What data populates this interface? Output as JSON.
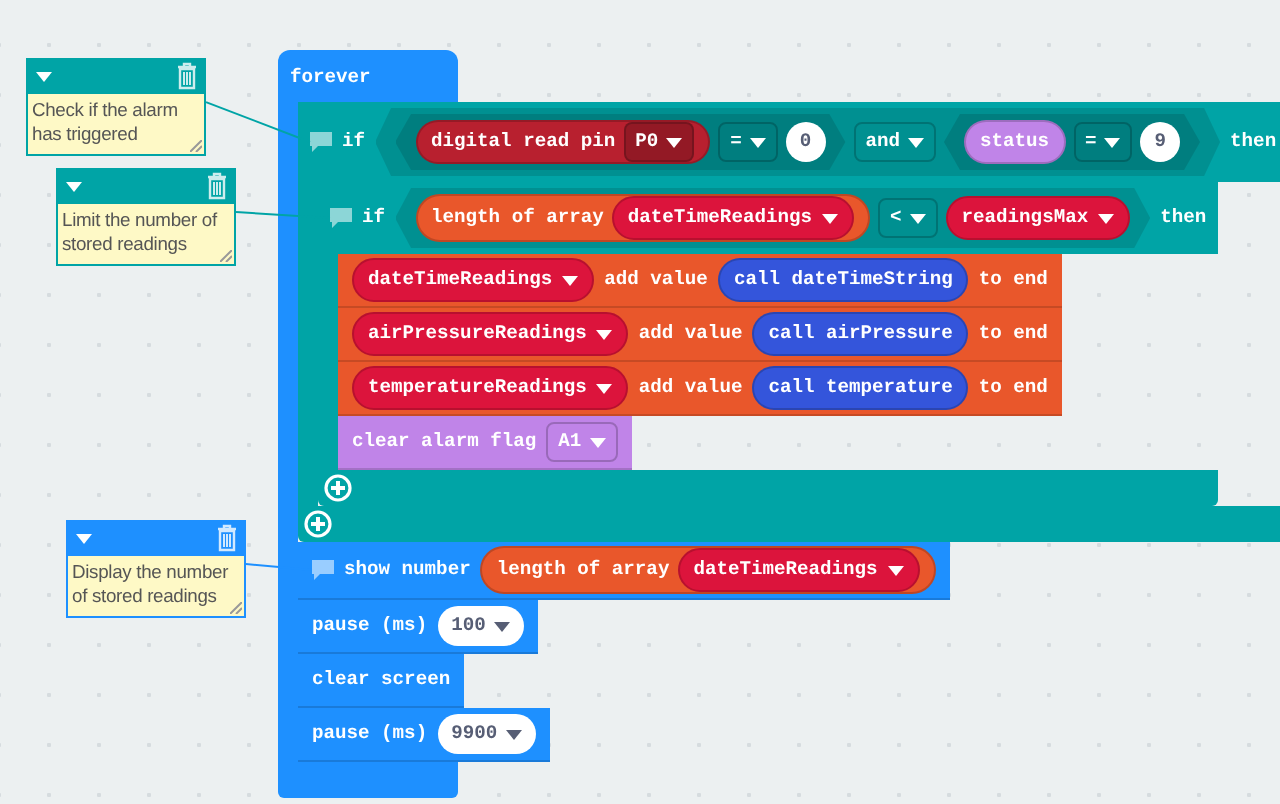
{
  "program": {
    "kind": "event",
    "color": "#1e90ff",
    "parts": [
      {
        "kind": "label",
        "text": "forever"
      }
    ],
    "children": [
      {
        "kind": "if",
        "color": "#00a4a6",
        "comment": "Check if the alarm has triggered",
        "parts": [
          {
            "kind": "label",
            "text": "if"
          },
          {
            "kind": "boolean",
            "parts": [
              {
                "kind": "boolean",
                "parts": [
                  {
                    "kind": "reporter",
                    "color": "#b8202f",
                    "parts": [
                      {
                        "kind": "label",
                        "text": "digital read pin"
                      },
                      {
                        "kind": "dropdown",
                        "text": "P0"
                      }
                    ]
                  },
                  {
                    "kind": "dropdown",
                    "text": "="
                  },
                  {
                    "kind": "number",
                    "text": "0"
                  }
                ]
              },
              {
                "kind": "dropdown",
                "text": "and"
              },
              {
                "kind": "boolean",
                "parts": [
                  {
                    "kind": "reporter",
                    "color": "#c084e8",
                    "parts": [
                      {
                        "kind": "label",
                        "text": "status"
                      }
                    ]
                  },
                  {
                    "kind": "dropdown",
                    "text": "="
                  },
                  {
                    "kind": "number",
                    "text": "9"
                  }
                ]
              }
            ]
          },
          {
            "kind": "label",
            "text": "then"
          }
        ],
        "children": [
          {
            "kind": "if",
            "color": "#00a4a6",
            "comment": "Limit the number of stored readings",
            "parts": [
              {
                "kind": "label",
                "text": "if"
              },
              {
                "kind": "boolean",
                "parts": [
                  {
                    "kind": "reporter",
                    "color": "#e9572b",
                    "parts": [
                      {
                        "kind": "label",
                        "text": "length of array"
                      },
                      {
                        "kind": "variable",
                        "text": "dateTimeReadings"
                      }
                    ]
                  },
                  {
                    "kind": "dropdown",
                    "text": "<"
                  },
                  {
                    "kind": "variable",
                    "text": "readingsMax"
                  }
                ]
              },
              {
                "kind": "label",
                "text": "then"
              }
            ],
            "children": [
              {
                "kind": "statement",
                "color": "#e9572b",
                "parts": [
                  {
                    "kind": "variable",
                    "text": "dateTimeReadings"
                  },
                  {
                    "kind": "label",
                    "text": "add value"
                  },
                  {
                    "kind": "reporter",
                    "color": "#3455db",
                    "parts": [
                      {
                        "kind": "label",
                        "text": "call dateTimeString"
                      }
                    ]
                  },
                  {
                    "kind": "label",
                    "text": "to end"
                  }
                ]
              },
              {
                "kind": "statement",
                "color": "#e9572b",
                "parts": [
                  {
                    "kind": "variable",
                    "text": "airPressureReadings"
                  },
                  {
                    "kind": "label",
                    "text": "add value"
                  },
                  {
                    "kind": "reporter",
                    "color": "#3455db",
                    "parts": [
                      {
                        "kind": "label",
                        "text": "call airPressure"
                      }
                    ]
                  },
                  {
                    "kind": "label",
                    "text": "to end"
                  }
                ]
              },
              {
                "kind": "statement",
                "color": "#e9572b",
                "parts": [
                  {
                    "kind": "variable",
                    "text": "temperatureReadings"
                  },
                  {
                    "kind": "label",
                    "text": "add value"
                  },
                  {
                    "kind": "reporter",
                    "color": "#3455db",
                    "parts": [
                      {
                        "kind": "label",
                        "text": "call temperature"
                      }
                    ]
                  },
                  {
                    "kind": "label",
                    "text": "to end"
                  }
                ]
              },
              {
                "kind": "statement",
                "color": "#c084e8",
                "parts": [
                  {
                    "kind": "label",
                    "text": "clear alarm flag"
                  },
                  {
                    "kind": "dropdown",
                    "text": "A1"
                  }
                ]
              }
            ]
          }
        ]
      },
      {
        "kind": "statement",
        "color": "#1e90ff",
        "comment": "Display the number of stored readings",
        "parts": [
          {
            "kind": "label",
            "text": "show number"
          },
          {
            "kind": "reporter",
            "color": "#e9572b",
            "parts": [
              {
                "kind": "label",
                "text": "length of array"
              },
              {
                "kind": "variable",
                "text": "dateTimeReadings"
              }
            ]
          }
        ]
      },
      {
        "kind": "statement",
        "color": "#1e90ff",
        "parts": [
          {
            "kind": "label",
            "text": "pause (ms)"
          },
          {
            "kind": "number",
            "text": "100",
            "menu": true
          }
        ]
      },
      {
        "kind": "statement",
        "color": "#1e90ff",
        "parts": [
          {
            "kind": "label",
            "text": "clear screen"
          }
        ]
      },
      {
        "kind": "statement",
        "color": "#1e90ff",
        "parts": [
          {
            "kind": "label",
            "text": "pause (ms)"
          },
          {
            "kind": "number",
            "text": "9900",
            "menu": true
          }
        ]
      }
    ]
  }
}
